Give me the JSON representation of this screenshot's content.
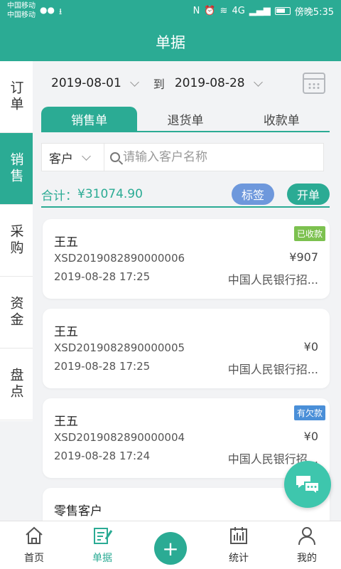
{
  "status_bar": {
    "carrier1": "中国移动",
    "carrier2": "中国移动",
    "network": "4G",
    "time": "傍晚5:35"
  },
  "app_bar": {
    "title": "单据"
  },
  "sidebar": {
    "items": [
      {
        "label": "订单",
        "active": false
      },
      {
        "label": "销售",
        "active": true
      },
      {
        "label": "采购",
        "active": false
      },
      {
        "label": "资金",
        "active": false
      },
      {
        "label": "盘点",
        "active": false
      }
    ]
  },
  "date_filter": {
    "start": "2019-08-01",
    "to_label": "到",
    "end": "2019-08-28"
  },
  "tabs": [
    {
      "label": "销售单",
      "active": true
    },
    {
      "label": "退货单",
      "active": false
    },
    {
      "label": "收款单",
      "active": false
    }
  ],
  "filter": {
    "field_label": "客户",
    "search_placeholder": "请输入客户名称"
  },
  "summary": {
    "total_label": "合计：",
    "total_value": "¥31074.90",
    "tag_button": "标签",
    "open_button": "开单"
  },
  "orders": [
    {
      "name": "王五",
      "number": "XSD2019082890000006",
      "time": "2019-08-28 17:25",
      "amount": "¥907",
      "bank": "中国人民银行招...",
      "badge": "已收款",
      "badge_color": "#7cc14f"
    },
    {
      "name": "王五",
      "number": "XSD2019082890000005",
      "time": "2019-08-28 17:25",
      "amount": "¥0",
      "bank": "中国人民银行招...",
      "badge": "",
      "badge_color": ""
    },
    {
      "name": "王五",
      "number": "XSD2019082890000004",
      "time": "2019-08-28 17:24",
      "amount": "¥0",
      "bank": "中国人民银行招...",
      "badge": "有欠款",
      "badge_color": "#4a8fd8"
    },
    {
      "name": "零售客户",
      "number": "",
      "time": "",
      "amount": "",
      "bank": "",
      "badge": "",
      "badge_color": ""
    }
  ],
  "bottom_nav": {
    "home": "首页",
    "docs": "单据",
    "stats": "统计",
    "mine": "我的"
  },
  "colors": {
    "primary": "#2bab94",
    "tag_blue": "#6e98dc",
    "fab": "#3ec6ad"
  }
}
